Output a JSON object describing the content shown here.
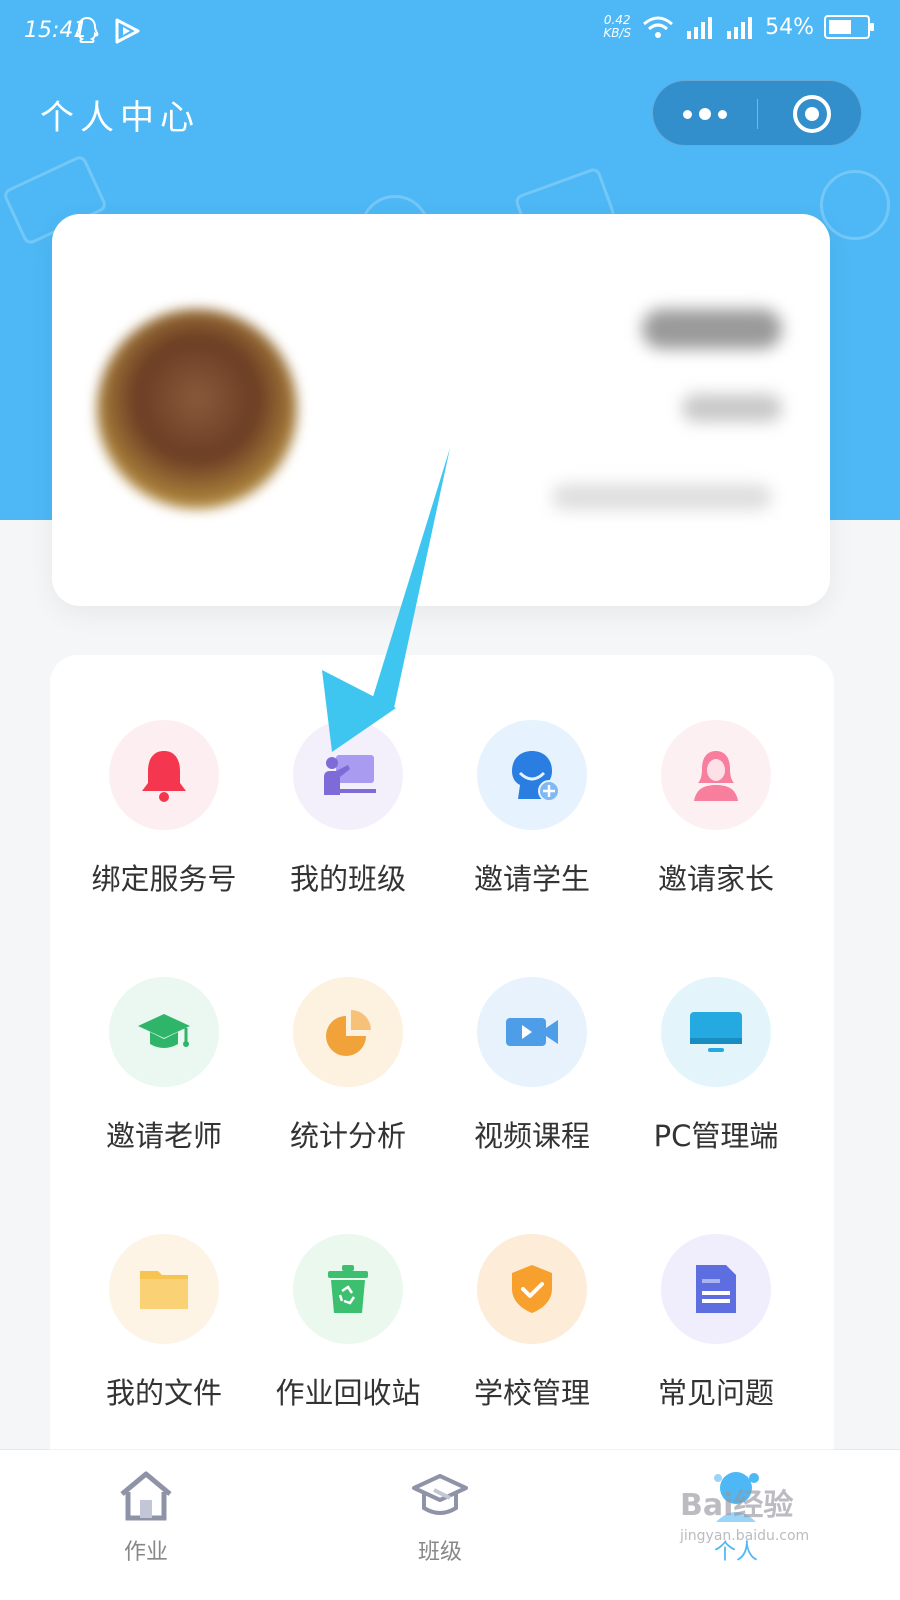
{
  "status_bar": {
    "time": "15:41",
    "net_speed_value": "0.42",
    "net_speed_unit": "KB/S",
    "battery": "54%"
  },
  "header": {
    "title": "个人中心"
  },
  "menu": {
    "items": [
      {
        "label": "绑定服务号",
        "icon": "bell-icon",
        "bg": "#fdeff1",
        "color": "#f5364f"
      },
      {
        "label": "我的班级",
        "icon": "classroom-icon",
        "bg": "#f3f0fc",
        "color": "#8b79df"
      },
      {
        "label": "邀请学生",
        "icon": "student-add-icon",
        "bg": "#e6f2fd",
        "color": "#2a7de1"
      },
      {
        "label": "邀请家长",
        "icon": "parent-icon",
        "bg": "#fdf0f3",
        "color": "#f77f9d"
      },
      {
        "label": "邀请老师",
        "icon": "graduation-cap-icon",
        "bg": "#eaf8f1",
        "color": "#2fb56a"
      },
      {
        "label": "统计分析",
        "icon": "pie-chart-icon",
        "bg": "#fdf1e0",
        "color": "#f1a238"
      },
      {
        "label": "视频课程",
        "icon": "video-camera-icon",
        "bg": "#e7f2fd",
        "color": "#4d9de9"
      },
      {
        "label": "PC管理端",
        "icon": "monitor-icon",
        "bg": "#e3f5fb",
        "color": "#24a9e0"
      },
      {
        "label": "我的文件",
        "icon": "folder-icon",
        "bg": "#fdf4e6",
        "color": "#f6c451"
      },
      {
        "label": "作业回收站",
        "icon": "recycle-bin-icon",
        "bg": "#ebf8ee",
        "color": "#3cc070"
      },
      {
        "label": "学校管理",
        "icon": "shield-icon",
        "bg": "#fdecd8",
        "color": "#f7a02d"
      },
      {
        "label": "常见问题",
        "icon": "document-icon",
        "bg": "#f0eefc",
        "color": "#5d6fe0"
      }
    ]
  },
  "tabs": [
    {
      "label": "作业",
      "icon": "home-icon",
      "active": false
    },
    {
      "label": "班级",
      "icon": "class-cap-icon",
      "active": false
    },
    {
      "label": "个人",
      "icon": "person-icon",
      "active": true
    }
  ],
  "watermark": {
    "text": "Bai经验",
    "url": "jingyan.baidu.com"
  },
  "colors": {
    "primary": "#4db8f5",
    "arrow": "#3fc6f0"
  }
}
